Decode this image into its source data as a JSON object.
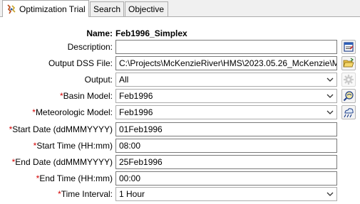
{
  "tabs": [
    {
      "label": "Optimization Trial",
      "icon": "optimization-trial-icon",
      "active": true
    },
    {
      "label": "Search",
      "active": false
    },
    {
      "label": "Objective",
      "active": false
    }
  ],
  "form": {
    "name_label": "Name:",
    "name_value": "Feb1996_Simplex",
    "description": {
      "label": "Description:",
      "value": ""
    },
    "output_dss": {
      "label": "Output DSS File:",
      "value": "C:\\Projects\\McKenzieRiver\\HMS\\2023.05.26_McKenzie\\M"
    },
    "output": {
      "label": "Output:",
      "value": "All"
    },
    "basin_model": {
      "required": "*",
      "label": "Basin Model:",
      "value": "Feb1996"
    },
    "met_model": {
      "required": "*",
      "label": "Meteorologic Model:",
      "value": "Feb1996"
    },
    "start_date": {
      "required": "*",
      "label": "Start Date (ddMMMYYYY)",
      "value": "01Feb1996"
    },
    "start_time": {
      "required": "*",
      "label": "Start Time (HH:mm)",
      "value": "08:00"
    },
    "end_date": {
      "required": "*",
      "label": "End Date (ddMMMYYYY)",
      "value": "25Feb1996"
    },
    "end_time": {
      "required": "*",
      "label": "End Time (HH:mm)",
      "value": "00:00"
    },
    "time_interval": {
      "required": "*",
      "label": "Time Interval:",
      "value": "1 Hour"
    }
  },
  "colors": {
    "required": "#d40000",
    "border": "#7a7a7a",
    "panel": "#ffffff",
    "chrome": "#f0f0f0"
  }
}
